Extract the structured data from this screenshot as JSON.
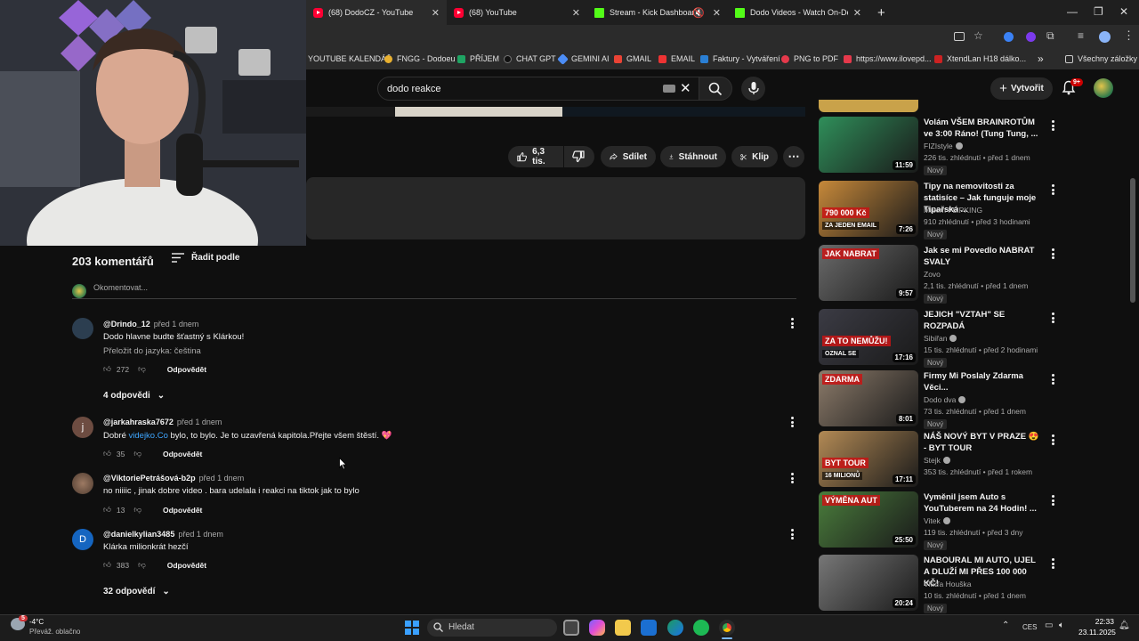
{
  "browser": {
    "tabs": [
      {
        "label": "(68) DodoCZ - YouTube",
        "type": "yt"
      },
      {
        "label": "(68) YouTube",
        "type": "yt"
      },
      {
        "label": "Stream - Kick Dashboard",
        "type": "kick"
      },
      {
        "label": "Dodo Videos - Watch On-Dem",
        "type": "kick"
      }
    ],
    "new_tab": "+",
    "bookmarks": [
      "YOUTUBE KALENDÁŘ",
      "FNGG - Dodoeu",
      "PŘÍJEM",
      "CHAT GPT",
      "GEMINI AI",
      "GMAIL",
      "EMAIL",
      "Faktury - Vytváření",
      "PNG to PDF",
      "https://www.ilovepd...",
      "XtendLan H18 dálko..."
    ],
    "all_bookmarks": "Všechny záložky",
    "bookmarks_more": "»"
  },
  "youtube": {
    "search_value": "dodo reakce",
    "create_label": "Vytvořit",
    "notifications_count": "9+"
  },
  "actions": {
    "likes": "6,3 tis.",
    "share": "Sdílet",
    "download": "Stáhnout",
    "clip": "Klip"
  },
  "comments": {
    "count_label": "203 komentářů",
    "sort_label": "Řadit podle",
    "add_placeholder": "Okomentovat...",
    "reply_label": "Odpovědět",
    "items": [
      {
        "author": "@Drindo_12",
        "time": "před 1 dnem",
        "text": "Dodo hlavne budte šťastný s Klárkou!",
        "translate": "Přeložit do jazyka: čeština",
        "likes": "272",
        "replies": "4 odpovědi"
      },
      {
        "author": "@jarkahraska7672",
        "time": "před 1 dnem",
        "text_pre": "Dobré ",
        "text_link": "videjko.Co",
        "text_post": " bylo, to bylo. Je to uzavřená kapitola.Přejte všem štěstí. 💖",
        "likes": "35",
        "avatar_letter": "j"
      },
      {
        "author": "@ViktoriePetrášová-b2p",
        "time": "před 1 dnem",
        "text": "no niiiic , jinak dobre video . bara udelala i reakci na tiktok jak to bylo",
        "likes": "13"
      },
      {
        "author": "@danielkylian3485",
        "time": "před 1 dnem",
        "text": "Klárka milionkrát hezčí",
        "likes": "383",
        "replies": "32 odpovědí",
        "avatar_letter": "D"
      }
    ]
  },
  "sidebar": {
    "videos": [
      {
        "title": "Volám VŠEM BRAINROTŮM ve 3:00 Ráno! (Tung Tung, ...",
        "channel": "FIZIstyle",
        "verified": true,
        "meta": "226 tis. zhlédnutí • před 1 dnem",
        "badge": "Nový",
        "duration": "11:59",
        "thumb": "#2f8f5a"
      },
      {
        "title": "Tipy na nemovitosti za statisíce – Jak funguje moje Tipařská ...",
        "channel": "Maxim FLIPKING",
        "verified": false,
        "meta": "910 zhlédnutí • před 3 hodinami",
        "badge": "Nový",
        "duration": "7:26",
        "thumb": "#c7893a",
        "overlay": "790 000 Kč",
        "overlay2": "ZA JEDEN EMAIL"
      },
      {
        "title": "Jak se mi Povedlo NABRAT SVALY",
        "channel": "Zovo",
        "verified": false,
        "meta": "2,1 tis. zhlédnutí • před 1 dnem",
        "badge": "Nový",
        "duration": "9:57",
        "thumb": "#6a6a6a",
        "overlay": "JAK NABRAT"
      },
      {
        "title": "JEJICH \"VZTAH\" SE ROZPADÁ",
        "channel": "Sibiřan",
        "verified": true,
        "meta": "15 tis. zhlédnutí • před 2 hodinami",
        "badge": "Nový",
        "duration": "17:16",
        "thumb": "#3b3b44",
        "overlay": "ZA TO NEMŮŽU!",
        "overlay2": "OZNAL SE"
      },
      {
        "title": "Firmy Mi Poslaly Zdarma Věci...",
        "channel": "Dodo dva",
        "verified": true,
        "meta": "73 tis. zhlédnutí • před 1 dnem",
        "badge": "Nový",
        "duration": "8:01",
        "thumb": "#8c7b6a",
        "overlay": "ZDARMA"
      },
      {
        "title": "NÁŠ NOVÝ BYT V PRAZE 😍 - BYT TOUR",
        "channel": "Stejk",
        "verified": true,
        "meta": "353 tis. zhlédnutí • před 1 rokem",
        "badge": "",
        "duration": "17:11",
        "thumb": "#b38a55",
        "overlay": "BYT TOUR",
        "overlay2": "16 MILIONŮ"
      },
      {
        "title": "Vyměnil jsem Auto s YouTuberem na 24 Hodin! ...",
        "channel": "Vitek",
        "verified": true,
        "meta": "119 tis. zhlédnutí • před 3 dny",
        "badge": "Nový",
        "duration": "25:50",
        "thumb": "#4a7d3c",
        "overlay": "VÝMĚNA AUT"
      },
      {
        "title": "NABOURAL MI AUTO, UJEL A DLUŽÍ MI PŘES 100 000 KČ!",
        "channel": "Vláďa Houška",
        "verified": false,
        "meta": "10 tis. zhlédnutí • před 1 dnem",
        "badge": "Nový",
        "duration": "20:24",
        "thumb": "#777777"
      }
    ]
  },
  "taskbar": {
    "weather_temp": "-4°C",
    "weather_desc": "Převáž. oblačno",
    "weather_alert": "5",
    "search_placeholder": "Hledat",
    "lang": "CES",
    "time": "22:33",
    "date": "23.11.2025"
  },
  "colors": {
    "accent_red": "#ff0033",
    "link_blue": "#3ea6ff",
    "kick_green": "#53fc18"
  }
}
